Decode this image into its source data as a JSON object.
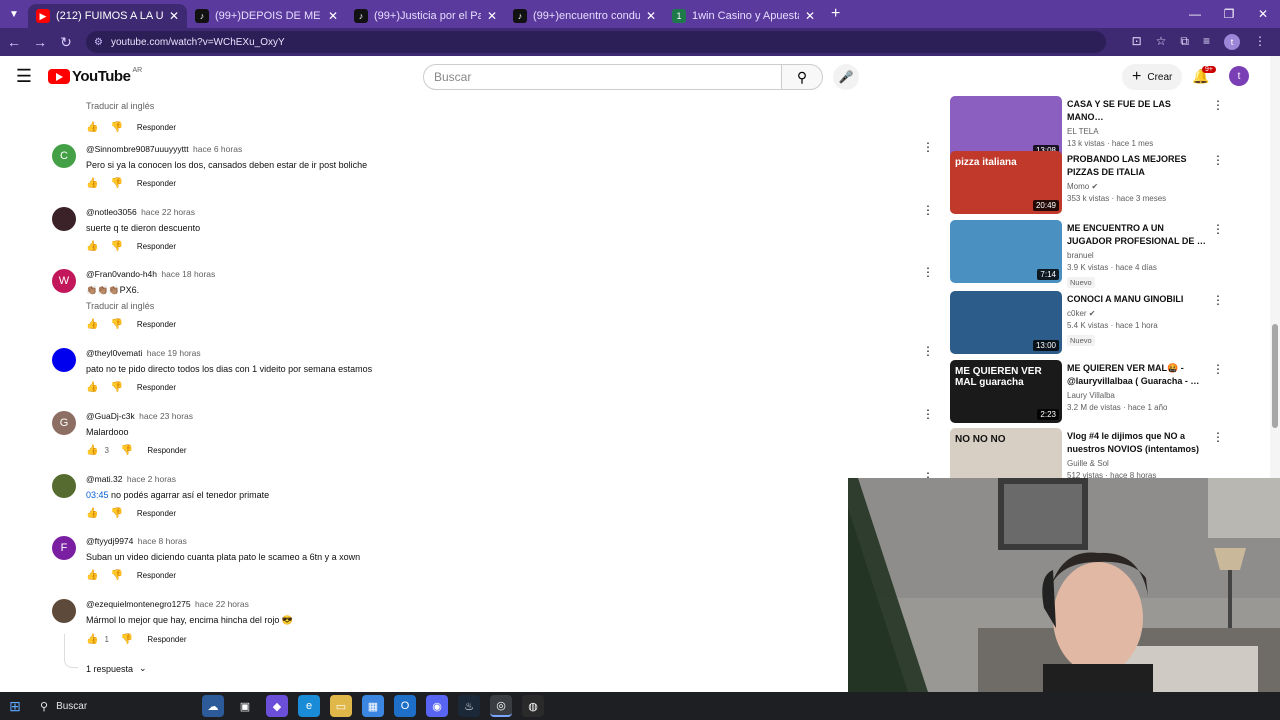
{
  "browser": {
    "tabs": [
      {
        "title": "(212) FUIMOS A LA UNICA PAR…",
        "favicon": "youtube-icon",
        "color": "#ff0000",
        "active": true
      },
      {
        "title": "(99+)DEPOIS DE ME JULGAR, El…",
        "favicon": "tiktok-icon",
        "color": "#111111",
        "active": false
      },
      {
        "title": "(99+)Justicia por el Padre: Men…",
        "favicon": "tiktok-icon",
        "color": "#111111",
        "active": false
      },
      {
        "title": "(99+)encuentro condu y xown …",
        "favicon": "tiktok-icon",
        "color": "#111111",
        "active": false
      },
      {
        "title": "1win Casino y Apuestas Deport…",
        "favicon": "casino-icon",
        "color": "#1e7a4a",
        "active": false
      }
    ],
    "new_tab": "+",
    "url": "youtube.com/watch?v=WChEXu_OxyY",
    "profile_initial": "t"
  },
  "youtube": {
    "logo_text": "YouTube",
    "country": "AR",
    "search_placeholder": "Buscar",
    "create_label": "Crear",
    "notif_badge": "9+",
    "avatar_initial": "t"
  },
  "comments": {
    "translate_top": "Traducir al inglés",
    "reply_label": "Responder",
    "items": [
      {
        "handle": "@Sinnombre9087uuuyyyttt",
        "time": "hace 6 horas",
        "text": "Pero si ya la conocen los dos, cansados deben estar de ir post boliche",
        "avatar": "C",
        "avatar_color": "#43a047"
      },
      {
        "handle": "@notleo3056",
        "time": "hace 22 horas",
        "text": "suerte q te dieron descuento",
        "avatar": "",
        "avatar_color": "#3a2228"
      },
      {
        "handle": "@Fran0vando-h4h",
        "time": "hace 18 horas",
        "text": "👏🏽👏🏽👏🏽PX6.",
        "translate": "Traducir al inglés",
        "avatar": "W",
        "avatar_color": "#c2185b"
      },
      {
        "handle": "@theyl0vemati",
        "time": "hace 19 horas",
        "text": "pato no te pido directo todos los dias con 1 videito por semana estamos",
        "avatar": "",
        "avatar_color": "#0000ee"
      },
      {
        "handle": "@GuaDj-c3k",
        "time": "hace 23 horas",
        "text": "Malardooo",
        "likes": "3",
        "avatar": "G",
        "avatar_color": "#8d6e63"
      },
      {
        "handle": "@mati.32",
        "time": "hace 2 horas",
        "timestamp": "03:45",
        "text": " no podés agarrar así el tenedor primate",
        "avatar": "",
        "avatar_color": "#556b2f"
      },
      {
        "handle": "@ftyydj9974",
        "time": "hace 8 horas",
        "text": "Suban un video diciendo cuanta plata pato le scameo a 6tn y a xown",
        "avatar": "F",
        "avatar_color": "#7b1fa2"
      },
      {
        "handle": "@ezequielmontenegro1275",
        "time": "hace 22 horas",
        "text": "Mármol lo mejor que hay, encima hincha del rojo 😎",
        "likes": "1",
        "avatar": "",
        "avatar_color": "#5d4a3a"
      }
    ],
    "replies_label": "1 respuesta"
  },
  "sidebar": {
    "videos": [
      {
        "title": "CASA Y SE FUE DE LAS MANO…",
        "channel": "EL TELA",
        "stats": "13 k vistas · hace 1 mes",
        "duration": "13:08",
        "thumb_color": "#8a5fbf"
      },
      {
        "title": "PROBANDO LAS MEJORES PIZZAS DE ITALIA",
        "channel": "Momo",
        "verified": "✔",
        "stats": "353 k vistas · hace 3 meses",
        "duration": "20:49",
        "thumb_color": "#c0392b",
        "thumb_text": "pizza italiana"
      },
      {
        "title": "ME ENCUENTRO A UN JUGADOR PROFESIONAL DE …",
        "channel": "branuel",
        "stats": "3.9 K vistas · hace 4 días",
        "badge": "Nuevo",
        "duration": "7:14",
        "thumb_color": "#4a90c0"
      },
      {
        "title": "CONOCI A MANU GINOBILI",
        "channel": "c0ker",
        "verified": "✔",
        "stats": "5.4 K vistas · hace 1 hora",
        "badge": "Nuevo",
        "duration": "13:00",
        "thumb_color": "#2c5d8a"
      },
      {
        "title": "ME QUIEREN VER MAL🤬 - @lauryvillalbaa ( Guaracha - …",
        "channel": "Laury Villalba",
        "stats": "3.2 M de vistas · hace 1 año",
        "duration": "2:23",
        "thumb_color": "#1a1a1a",
        "thumb_text": "ME QUIEREN VER MAL guaracha"
      },
      {
        "title": "Vlog #4 le dijimos que NO a nuestros NOVIOS (intentamos)",
        "channel": "Guille & Sol",
        "stats": "512 vistas · hace 8 horas",
        "duration": "",
        "thumb_color": "#d8cfc4",
        "thumb_text": "NO NO NO"
      }
    ]
  },
  "taskbar": {
    "search_label": "Buscar"
  }
}
